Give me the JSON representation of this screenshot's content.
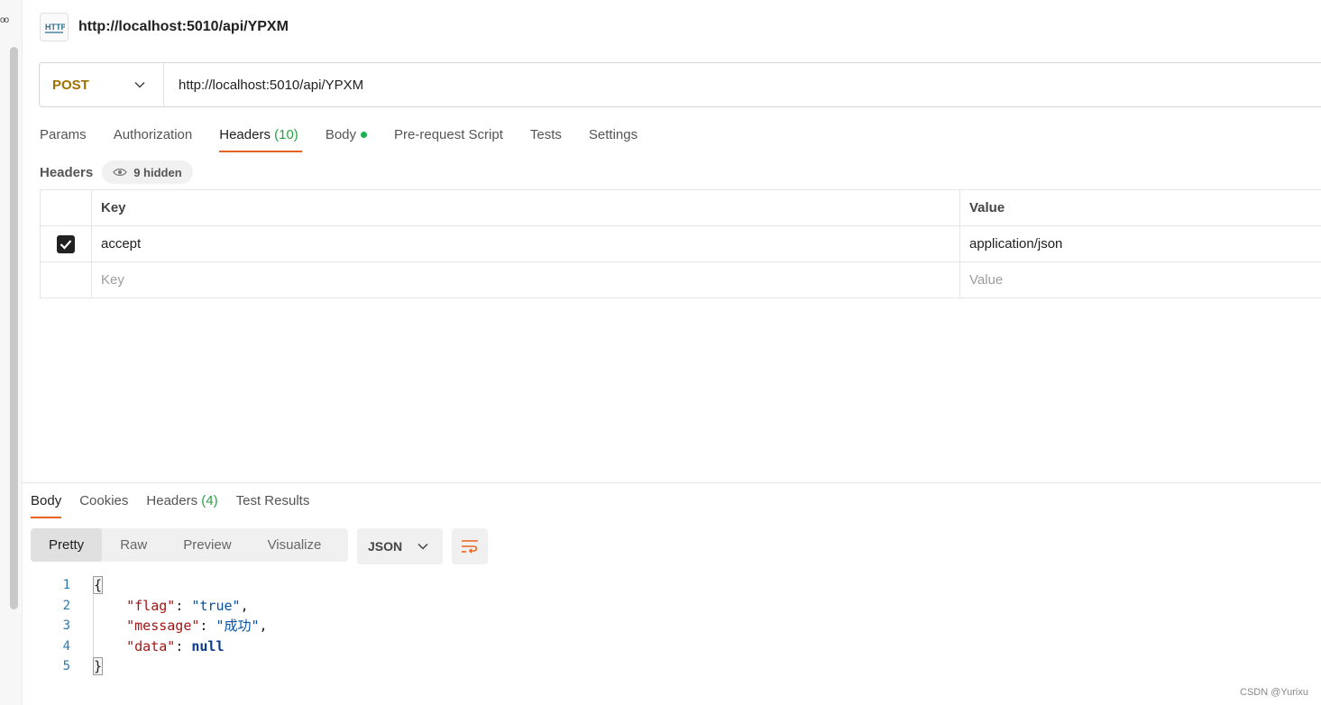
{
  "left_strip": {
    "dots": "oo"
  },
  "request": {
    "icon": "http-icon",
    "title": "http://localhost:5010/api/YPXM",
    "method": "POST",
    "url": "http://localhost:5010/api/YPXM"
  },
  "request_tabs": {
    "params": "Params",
    "authorization": "Authorization",
    "headers": "Headers",
    "headers_count": "(10)",
    "body": "Body",
    "prerequest": "Pre-request Script",
    "tests": "Tests",
    "settings": "Settings"
  },
  "headers_section": {
    "label": "Headers",
    "hidden": "9 hidden",
    "col_key": "Key",
    "col_value": "Value",
    "rows": [
      {
        "key": "accept",
        "value": "application/json",
        "checked": true
      }
    ],
    "new_key_placeholder": "Key",
    "new_value_placeholder": "Value"
  },
  "response_tabs": {
    "body": "Body",
    "cookies": "Cookies",
    "headers": "Headers",
    "headers_count": "(4)",
    "test_results": "Test Results"
  },
  "response_view": {
    "modes": [
      "Pretty",
      "Raw",
      "Preview",
      "Visualize"
    ],
    "active_mode": "Pretty",
    "format": "JSON"
  },
  "code_lines": [
    {
      "num": "1",
      "open": "{"
    },
    {
      "num": "2",
      "key": "\"flag\"",
      "sep": ": ",
      "val": "\"true\"",
      "tail": ","
    },
    {
      "num": "3",
      "key": "\"message\"",
      "sep": ": ",
      "val": "\"成功\"",
      "tail": ","
    },
    {
      "num": "4",
      "key": "\"data\"",
      "sep": ": ",
      "val": "null",
      "tail": ""
    },
    {
      "num": "5",
      "close": "}"
    }
  ],
  "watermark": "CSDN @Yurixu",
  "colors": {
    "accent": "#e8641e",
    "method_post": "#a07000",
    "count_green": "#27a243",
    "body_dot": "#17b350"
  }
}
